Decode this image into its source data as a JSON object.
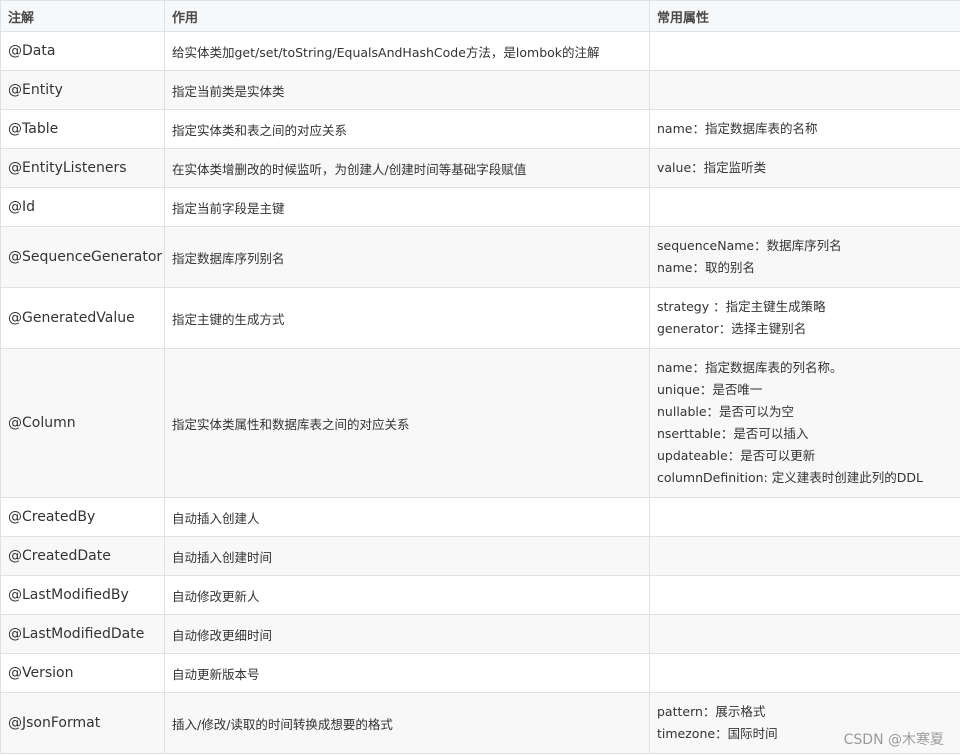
{
  "header": {
    "annotation": "注解",
    "purpose": "作用",
    "attributes": "常用属性"
  },
  "rows": [
    {
      "annotation": "@Data",
      "purpose": "给实体类加get/set/toString/EqualsAndHashCode方法，是lombok的注解",
      "attributes": []
    },
    {
      "annotation": "@Entity",
      "purpose": "指定当前类是实体类",
      "attributes": []
    },
    {
      "annotation": "@Table",
      "purpose": "指定实体类和表之间的对应关系",
      "attributes": [
        "name：指定数据库表的名称"
      ]
    },
    {
      "annotation": "@EntityListeners",
      "purpose": "在实体类增删改的时候监听，为创建人/创建时间等基础字段赋值",
      "attributes": [
        "value：指定监听类"
      ]
    },
    {
      "annotation": "@Id",
      "purpose": "指定当前字段是主键",
      "attributes": []
    },
    {
      "annotation": "@SequenceGenerator",
      "purpose": "指定数据库序列别名",
      "attributes": [
        "sequenceName：数据库序列名",
        "name：取的别名"
      ]
    },
    {
      "annotation": "@GeneratedValue",
      "purpose": "指定主键的生成方式",
      "attributes": [
        "strategy ：指定主键生成策略",
        "generator：选择主键别名"
      ]
    },
    {
      "annotation": "@Column",
      "purpose": "指定实体类属性和数据库表之间的对应关系",
      "attributes": [
        "name：指定数据库表的列名称。",
        "unique：是否唯一",
        "nullable：是否可以为空",
        "nserttable：是否可以插入",
        "updateable：是否可以更新",
        "columnDefinition: 定义建表时创建此列的DDL"
      ]
    },
    {
      "annotation": "@CreatedBy",
      "purpose": "自动插入创建人",
      "attributes": []
    },
    {
      "annotation": "@CreatedDate",
      "purpose": "自动插入创建时间",
      "attributes": []
    },
    {
      "annotation": "@LastModifiedBy",
      "purpose": "自动修改更新人",
      "attributes": []
    },
    {
      "annotation": "@LastModifiedDate",
      "purpose": "自动修改更细时间",
      "attributes": []
    },
    {
      "annotation": "@Version",
      "purpose": "自动更新版本号",
      "attributes": []
    },
    {
      "annotation": "@JsonFormat",
      "purpose": "插入/修改/读取的时间转换成想要的格式",
      "attributes": [
        "pattern：展示格式",
        "timezone：国际时间"
      ]
    }
  ],
  "watermark": "CSDN @木寒夏"
}
